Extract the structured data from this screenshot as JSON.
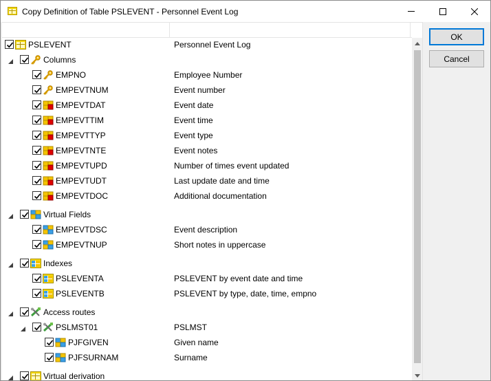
{
  "window": {
    "title": "Copy Definition of Table PSLEVENT - Personnel Event Log"
  },
  "buttons": {
    "ok": "OK",
    "cancel": "Cancel"
  },
  "tree": {
    "root": {
      "name": "PSLEVENT",
      "description": "Personnel Event Log",
      "checked": true,
      "icon": "table-icon"
    },
    "columns_group": {
      "name": "Columns",
      "checked": true,
      "icon": "key-icon"
    },
    "columns": [
      {
        "name": "EMPNO",
        "description": "Employee Number",
        "checked": true,
        "icon": "key-icon"
      },
      {
        "name": "EMPEVTNUM",
        "description": "Event number",
        "checked": true,
        "icon": "key-icon"
      },
      {
        "name": "EMPEVTDAT",
        "description": "Event date",
        "checked": true,
        "icon": "column-icon"
      },
      {
        "name": "EMPEVTTIM",
        "description": "Event time",
        "checked": true,
        "icon": "column-icon"
      },
      {
        "name": "EMPEVTTYP",
        "description": "Event type",
        "checked": true,
        "icon": "column-icon"
      },
      {
        "name": "EMPEVTNTE",
        "description": "Event notes",
        "checked": true,
        "icon": "column-icon"
      },
      {
        "name": "EMPEVTUPD",
        "description": "Number of times event updated",
        "checked": true,
        "icon": "column-icon"
      },
      {
        "name": "EMPEVTUDT",
        "description": "Last update date and time",
        "checked": true,
        "icon": "column-icon"
      },
      {
        "name": "EMPEVTDOC",
        "description": "Additional documentation",
        "checked": true,
        "icon": "column-icon"
      }
    ],
    "virtual_group": {
      "name": "Virtual Fields",
      "checked": true,
      "icon": "virtual-field-icon"
    },
    "virtual_fields": [
      {
        "name": "EMPEVTDSC",
        "description": "Event description",
        "checked": true,
        "icon": "virtual-field-icon"
      },
      {
        "name": "EMPEVTNUP",
        "description": "Short notes in uppercase",
        "checked": true,
        "icon": "virtual-field-icon"
      }
    ],
    "indexes_group": {
      "name": "Indexes",
      "checked": true,
      "icon": "index-icon"
    },
    "indexes": [
      {
        "name": "PSLEVENTA",
        "description": "PSLEVENT by event date and time",
        "checked": true,
        "icon": "index-icon"
      },
      {
        "name": "PSLEVENTB",
        "description": "PSLEVENT by type, date, time, empno",
        "checked": true,
        "icon": "index-icon"
      }
    ],
    "access_group": {
      "name": "Access routes",
      "checked": true,
      "icon": "access-route-icon"
    },
    "access_routes": [
      {
        "name": "PSLMST01",
        "description": "PSLMST",
        "checked": true,
        "icon": "access-route-icon"
      }
    ],
    "access_fields": [
      {
        "name": "PJFGIVEN",
        "description": "Given name",
        "checked": true,
        "icon": "virtual-field-icon"
      },
      {
        "name": "PJFSURNAM",
        "description": "Surname",
        "checked": true,
        "icon": "virtual-field-icon"
      }
    ],
    "derivation_group": {
      "name": "Virtual derivation",
      "checked": true,
      "icon": "table-icon"
    }
  },
  "colors": {
    "accent": "#0078d7",
    "title_bg": "#ffffff",
    "dialog_bg": "#f0f0f0",
    "column_icon_yellow": "#f5c400",
    "column_icon_red": "#e00000",
    "virtual_icon_blue": "#3aa0e6"
  }
}
